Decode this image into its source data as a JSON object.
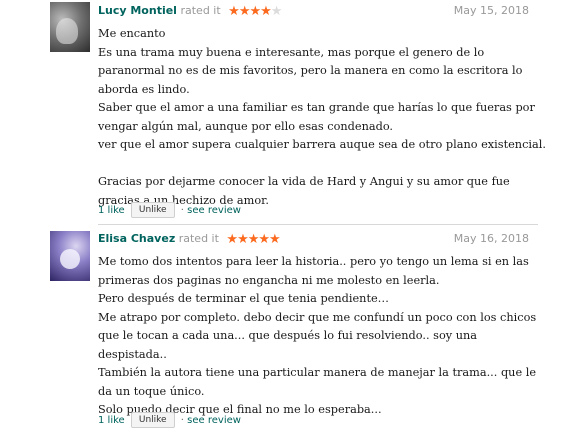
{
  "reviews": [
    {
      "user": "Lucy Montiel",
      "action": "rated it",
      "rating": 4,
      "stars_max": 5,
      "date": "May 15, 2018",
      "lines": [
        "Me encanto",
        "Es una trama muy buena e interesante, mas porque el genero de lo",
        "paranormal no es de mis favoritos, pero la manera en como la escritora lo",
        "aborda es lindo.",
        "Saber que el amor a una familiar es tan grande que harías lo que fueras por",
        "vengar algún mal, aunque por ello esas condenado.",
        "ver que el amor supera cualquier barrera auque sea de otro plano existencial.",
        "",
        "Gracias por dejarme conocer la vida de Hard y Angui y su amor que fue",
        "gracias a un hechizo de amor."
      ],
      "likes": "1 like",
      "sep1": "·",
      "unlike_label": "Unlike",
      "sep2": "·",
      "see_review": "see review"
    },
    {
      "user": "Elisa Chavez",
      "action": "rated it",
      "rating": 5,
      "stars_max": 5,
      "date": "May 16, 2018",
      "lines": [
        "Me tomo dos intentos para leer la historia.. pero yo tengo un lema si en las",
        "primeras dos paginas no engancha ni me molesto en leerla.",
        "Pero después de terminar el que tenia pendiente…",
        "Me atrapo por completo. debo decir que me confundí un poco con los chicos",
        "que le tocan a cada una... que después lo fui resolviendo.. soy una",
        "despistada..",
        "También la autora tiene una particular manera de manejar la trama... que le",
        "da un toque único.",
        "Solo puedo decir que el final no me lo esperaba...",
        ""
      ],
      "likes": "1 like",
      "sep1": "·",
      "unlike_label": "Unlike",
      "sep2": "·",
      "see_review": "see review"
    }
  ],
  "colors": {
    "username": "#00635d",
    "star_on": "#fb6a1f",
    "star_off": "#dcdcdc",
    "meta_text": "#999999"
  },
  "icons": {
    "star": "★"
  }
}
